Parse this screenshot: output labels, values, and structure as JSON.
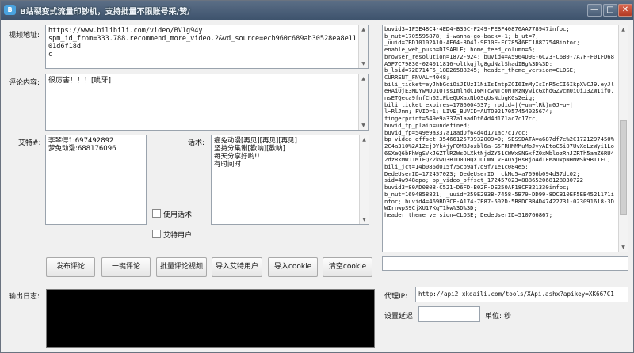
{
  "window": {
    "title": "B站裂变式流量印钞机，支持批量不限账号采/赞/",
    "icon_text": "B",
    "minimize_glyph": "—",
    "maximize_glyph": "□",
    "close_glyph": "✕"
  },
  "labels": {
    "video_url": "视频地址:",
    "comment_content": "评论内容:",
    "at_users": "艾特#:",
    "phrases": "话术:",
    "output_log": "输出日志:",
    "proxy_ip": "代理IP:",
    "delay": "设置延迟:",
    "unit": "单位: 秒"
  },
  "fields": {
    "video_url": "https://www.bilibili.com/video/BV1g94y\nspm_id_from=333.788.recommend_more_video.2&vd_source=ecb960c689ab30528ea8e1101d6f18d\nc",
    "comment": "很厉害！！！[呲牙]",
    "at_users": "李琴得1:697492892\n梦兔动漫:688176096",
    "phrases": "瘤兔动漫[再见][再见][再见]\n坚持分集谢[歡呐][歡呐]\n每天分享好哟!!\n有时间时",
    "proxy_ip": "http://api2.xkdaili.com/tools/XApi.ashx?apikey=XK667C1",
    "delay": "",
    "extra": "",
    "cookies": "buvid3=1F5E48C4-4ED4-B35C-F249-FEBF40876AA778947infoc;\nb_nut=1705595878; i-wanna-go-back=-1; b_ut=7;\n_uuid=7BD10102A10-AE64-8D41-9F10E-FC78546FC18877548infoc;\nenable_web_push=DISABLE; home_feed_column=5;\nbrowser_resolution=1872-924; buvid4=A5964D9E-6C23-C6B0-7A7F-F01FD68A5F7C79830-024011816-oltkqjlg8gdNzlShadIBg%3D%3D;\nb_lsid=72B714F5_18D26588245; header_theme_version=CLOSE;\nCURRENT_FNVAL=4048;\nbili_ticket=eyJhbGciOiJIUzI1NiIsImtpZCI6ImMyIsInR5cCI6IkpXVCJ9.eyJleHAiOjE3MDYwMDQ1OTssImlhdCI6MTcwNTc0NTMzNywicGxhdGZvcm0iOiJ3ZWIifQ.nsETQeca9fnfCh62iFbeQUXaxNbOSqUsNcbgKGs2eig;\nbili_ticket_expires=1706004537; rpdid=|(~um~lRk)m0J~u~|\nl~RlJmm; FVID=1; LIVE_BUVID=AUTO9217057454025674;\nfingerprint=549e9a337a1aadDf64d4d171ac7c17cc;\nbuvid_fp_plain=undefined;\nbuvid_fp=549e9a337a1aadDf64d4d171ac7c17cc;\nbp_video_offset_3546612573932009=0; SESSDATA=a687df7e%2C1721297450%2C4a310%2A12cjDYk4jyFOM8Jozbl6a-G5FRHMMMuMpJvyAEtoC5i07UvXdLzWyi1Lo6SXeQ6bFhWgSVkJGZTlRZWsOLXktNjdZY51CWWxSNGxfZ0xMblozRnJZRTh5amZ6RU42dzRkMWJ1MTFQZ2kwQ3B1U0JHQXJOLWNLVFAOYjRsRjo4dTFMaUxpNHNWSk9BIIEC;\nbili_jct=14b086d015f75cb9af7d9f71e1c084e5;\nDedeUserID=172457023; DedeUserID__ckMd5=a7696b094d37dc02;\nsid=4w948dpo; bp_video_offset_172457023=888652068128030722\nbuvid3=80AD0808-C521-D6FD-B02F-DE250AF18CF321330infoc;\nb_nut=1694858821; _uuid=259E293B-7458-5B79-DD99-8DCB10EF5EB4521171infoc; buvid4=469BD3CF-A174-7E87-502D-5B8DCBB4D47422731-023091618-3DWIrnwpS9CjXU17KqT1kw%3D%3D;\nheader_theme_version=CLOSE; DedeUserID=510766867;"
  },
  "checkboxes": [
    {
      "label": "使用话术",
      "checked": false
    },
    {
      "label": "艾特用户",
      "checked": false
    }
  ],
  "buttons": [
    "发布评论",
    "一键评论",
    "批量评论视频",
    "导入艾特用户",
    "导入cookie",
    "清空cookie"
  ],
  "colors": {
    "titlebar": "#4a5e78",
    "close_button": "#c74a33",
    "log_background": "#000000"
  }
}
